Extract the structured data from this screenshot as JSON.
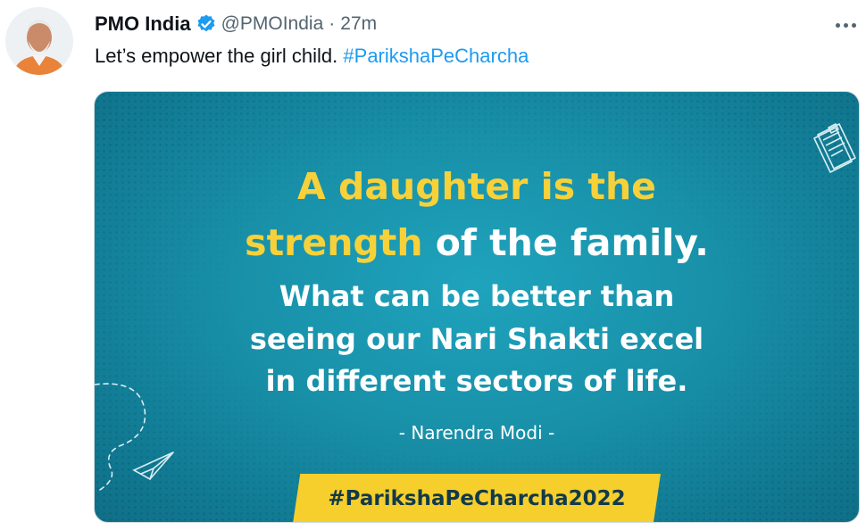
{
  "tweet": {
    "author_name": "PMO India",
    "handle": "@PMOIndia",
    "separator": "·",
    "time": "27m",
    "text_plain": "Let’s empower the girl child. ",
    "text_hashtag": "#ParikshaPeCharcha"
  },
  "image": {
    "line1": "A daughter is the",
    "line2_yellow": "strength",
    "line2_white": " of the family.",
    "line3": "What can be better than",
    "line4": "seeing our Nari Shakti excel",
    "line5": "in different sectors of life.",
    "author": "- Narendra Modi -",
    "banner": "#ParikshaPeCharcha2022"
  },
  "icons": {
    "verified": "verified-badge-icon",
    "more": "more-options-icon",
    "doc": "document-doodle-icon",
    "plane": "paper-plane-doodle-icon"
  },
  "colors": {
    "link": "#1d9bf0",
    "verified": "#1d9bf0",
    "teal": "#1890a8",
    "yellow": "#f7d13a"
  }
}
